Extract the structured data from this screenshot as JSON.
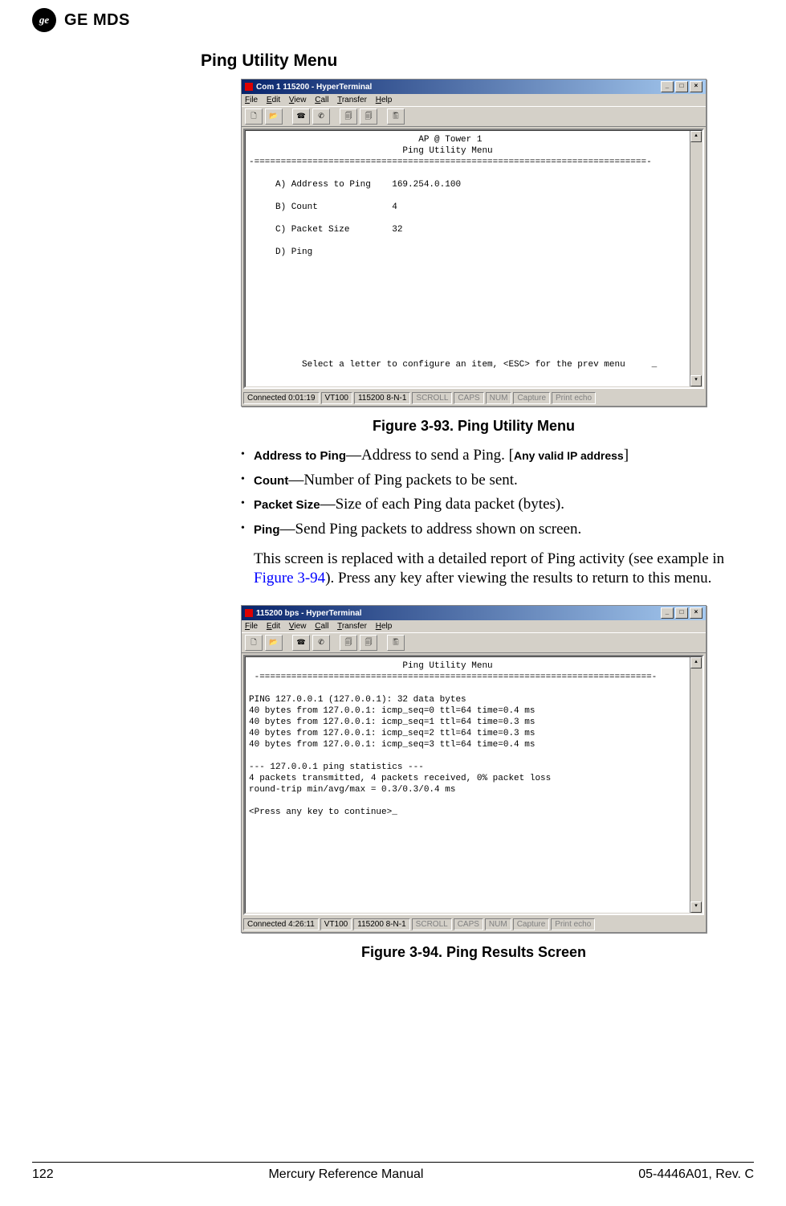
{
  "header": {
    "brand": "GE MDS",
    "logo_text": "ge"
  },
  "section_title": "Ping Utility Menu",
  "fig1": {
    "window_title": "Com 1 115200 - HyperTerminal",
    "menus": [
      "File",
      "Edit",
      "View",
      "Call",
      "Transfer",
      "Help"
    ],
    "terminal": "                                AP @ Tower 1\n                             Ping Utility Menu\n-==========================================================================-\n\n     A) Address to Ping    169.254.0.100\n\n     B) Count              4\n\n     C) Packet Size        32\n\n     D) Ping\n\n\n\n\n\n\n\n\n\n          Select a letter to configure an item, <ESC> for the prev menu     _",
    "status": {
      "conn": "Connected 0:01:19",
      "emul": "VT100",
      "ser": "115200 8-N-1",
      "scroll": "SCROLL",
      "caps": "CAPS",
      "num": "NUM",
      "capture": "Capture",
      "pecho": "Print echo"
    },
    "caption": "Figure 3-93. Ping Utility Menu"
  },
  "bullets": {
    "b1_term": "Address to Ping",
    "b1_text": "—Address to send a Ping. [",
    "b1_valid": "Any valid IP address",
    "b1_close": "]",
    "b2_term": "Count",
    "b2_text": "—Number of Ping packets to be sent.",
    "b3_term": "Packet Size",
    "b3_text": "—Size of each Ping data packet (bytes).",
    "b4_term": "Ping",
    "b4_text": "—Send Ping packets to address shown on screen."
  },
  "sub_para": {
    "p1": "This screen is replaced with a detailed report of Ping activity (see example in ",
    "link": "Figure 3-94",
    "p2": "). Press any key after viewing the results to return to this menu."
  },
  "fig2": {
    "window_title": "115200 bps - HyperTerminal",
    "menus": [
      "File",
      "Edit",
      "View",
      "Call",
      "Transfer",
      "Help"
    ],
    "terminal": "                             Ping Utility Menu\n -==========================================================================-\n\nPING 127.0.0.1 (127.0.0.1): 32 data bytes\n40 bytes from 127.0.0.1: icmp_seq=0 ttl=64 time=0.4 ms\n40 bytes from 127.0.0.1: icmp_seq=1 ttl=64 time=0.3 ms\n40 bytes from 127.0.0.1: icmp_seq=2 ttl=64 time=0.3 ms\n40 bytes from 127.0.0.1: icmp_seq=3 ttl=64 time=0.4 ms\n\n--- 127.0.0.1 ping statistics ---\n4 packets transmitted, 4 packets received, 0% packet loss\nround-trip min/avg/max = 0.3/0.3/0.4 ms\n\n<Press any key to continue>_",
    "status": {
      "conn": "Connected 4:26:11",
      "emul": "VT100",
      "ser": "115200 8-N-1",
      "scroll": "SCROLL",
      "caps": "CAPS",
      "num": "NUM",
      "capture": "Capture",
      "pecho": "Print echo"
    },
    "caption": "Figure 3-94. Ping Results Screen"
  },
  "footer": {
    "page": "122",
    "center": "Mercury Reference Manual",
    "right": "05-4446A01, Rev. C"
  }
}
